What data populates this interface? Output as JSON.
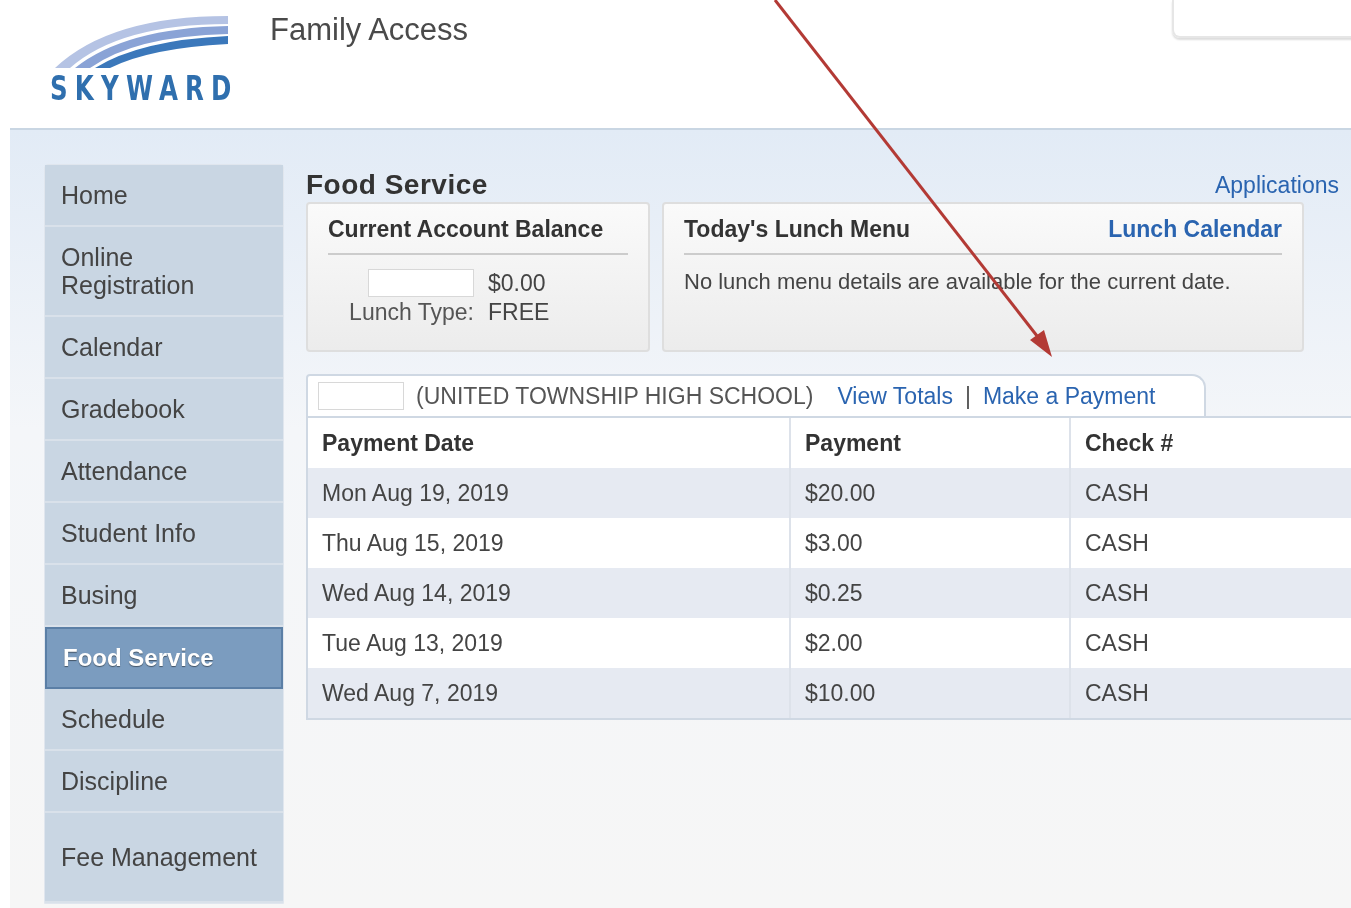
{
  "header": {
    "logo": "SKYWARD",
    "title": "Family Access"
  },
  "sidebar": {
    "items": [
      {
        "label": "Home",
        "selected": false
      },
      {
        "label": "Online Registration",
        "selected": false
      },
      {
        "label": "Calendar",
        "selected": false
      },
      {
        "label": "Gradebook",
        "selected": false
      },
      {
        "label": "Attendance",
        "selected": false
      },
      {
        "label": "Student Info",
        "selected": false
      },
      {
        "label": "Busing",
        "selected": false
      },
      {
        "label": "Food Service",
        "selected": true
      },
      {
        "label": "Schedule",
        "selected": false
      },
      {
        "label": "Discipline",
        "selected": false
      },
      {
        "label": "Fee Management",
        "selected": false
      }
    ]
  },
  "page": {
    "title": "Food Service",
    "link": "Applications"
  },
  "balance_card": {
    "title": "Current Account Balance",
    "balance": "$0.00",
    "lunch_type_label": "Lunch Type:",
    "lunch_type": "FREE"
  },
  "menu_card": {
    "title": "Today's Lunch Menu",
    "link": "Lunch Calendar",
    "message": "No lunch menu details are available for the current date."
  },
  "account_tab": {
    "school": "(UNITED TOWNSHIP HIGH SCHOOL)",
    "links": [
      "View Totals",
      "Make a Payment"
    ],
    "separator": "|"
  },
  "table": {
    "columns": [
      "Payment Date",
      "Payment",
      "Check #"
    ],
    "rows": [
      [
        "Mon Aug 19, 2019",
        "$20.00",
        "CASH"
      ],
      [
        "Thu Aug 15, 2019",
        "$3.00",
        "CASH"
      ],
      [
        "Wed Aug 14, 2019",
        "$0.25",
        "CASH"
      ],
      [
        "Tue Aug 13, 2019",
        "$2.00",
        "CASH"
      ],
      [
        "Wed Aug 7, 2019",
        "$10.00",
        "CASH"
      ]
    ]
  }
}
